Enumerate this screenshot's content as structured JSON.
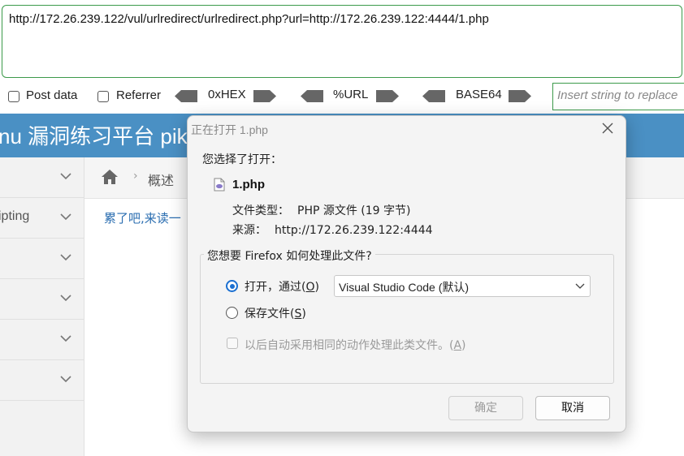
{
  "hackbar": {
    "url": "http://172.26.239.122/vul/urlredirect/urlredirect.php?url=http://172.26.239.122:4444/1.php",
    "post_data_label": "Post data",
    "referrer_label": "Referrer",
    "hex_label": "0xHEX",
    "url_enc_label": "%URL",
    "base64_label": "BASE64",
    "replace_placeholder": "Insert string to replace"
  },
  "site": {
    "banner_title": "nu 漏洞练习平台 pika",
    "sidebar_items": [
      "",
      "ipting",
      "",
      "",
      "",
      "",
      ""
    ],
    "breadcrumb_sep": "›",
    "breadcrumb": "概述",
    "content_link": "累了吧,来读一"
  },
  "dialog": {
    "title": "正在打开 1.php",
    "chosen_text": "您选择了打开：",
    "file_name": "1.php",
    "file_type_label": "文件类型：",
    "file_type_value": "PHP 源文件 (19 字节)",
    "source_label": "来源：",
    "source_value": "http://172.26.239.122:4444",
    "question": "您想要 Firefox 如何处理此文件?",
    "open_with_label": "打开，通过(",
    "open_with_key": "O",
    "open_with_suffix": ")",
    "app_selected": "Visual Studio Code (默认)",
    "save_label": "保存文件(",
    "save_key": "S",
    "save_suffix": ")",
    "auto_label": "以后自动采用相同的动作处理此类文件。(",
    "auto_key": "A",
    "auto_suffix": ")",
    "ok_label": "确定",
    "cancel_label": "取消"
  },
  "colors": {
    "banner": "#4a90c4",
    "accent": "#1a6fd1",
    "hackbar_border": "#3c9a4a",
    "link": "#2a6db0"
  }
}
